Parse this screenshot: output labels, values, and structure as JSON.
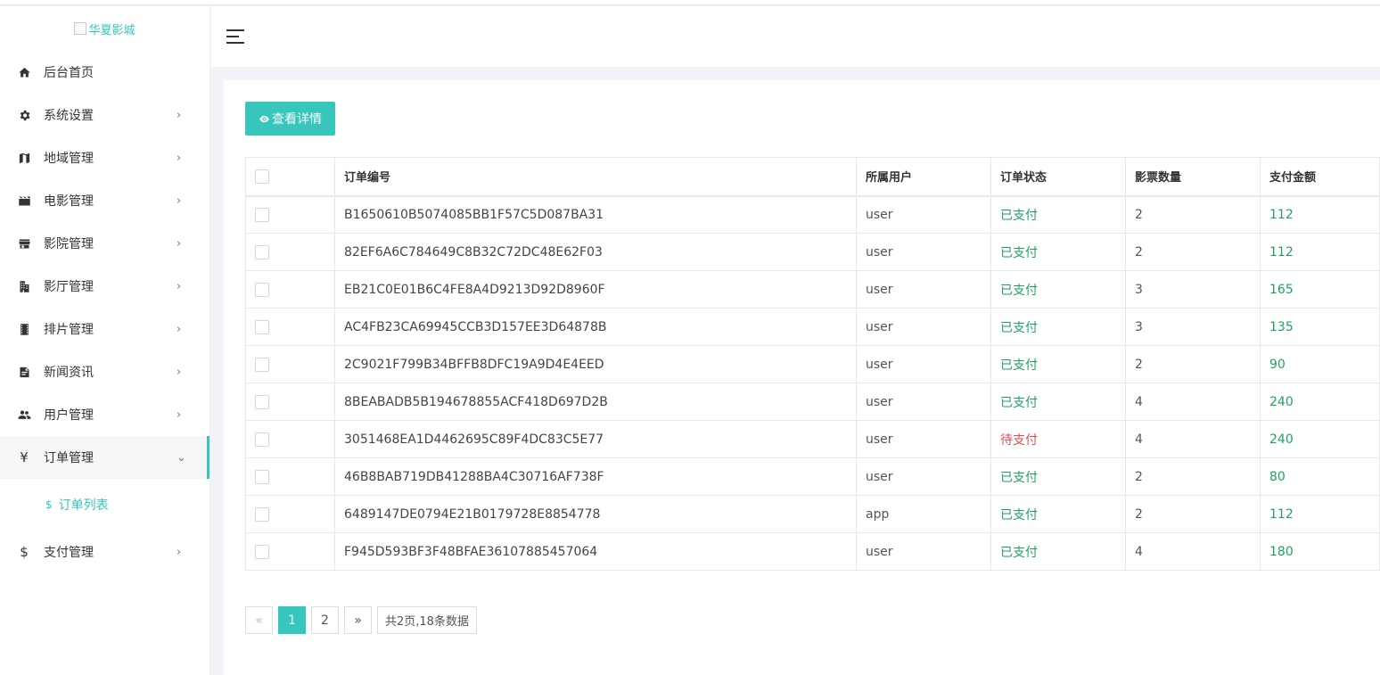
{
  "logo": {
    "alt_text": "华夏影城"
  },
  "sidebar": {
    "items": [
      {
        "label": "后台首页",
        "icon": "home-icon",
        "arrow": ""
      },
      {
        "label": "系统设置",
        "icon": "gear-icon",
        "arrow": "›"
      },
      {
        "label": "地域管理",
        "icon": "map-icon",
        "arrow": "›"
      },
      {
        "label": "电影管理",
        "icon": "film-icon",
        "arrow": "›"
      },
      {
        "label": "影院管理",
        "icon": "store-icon",
        "arrow": "›"
      },
      {
        "label": "影厅管理",
        "icon": "building-icon",
        "arrow": "›"
      },
      {
        "label": "排片管理",
        "icon": "filmstrip-icon",
        "arrow": "›"
      },
      {
        "label": "新闻资讯",
        "icon": "document-icon",
        "arrow": "›"
      },
      {
        "label": "用户管理",
        "icon": "users-icon",
        "arrow": "›"
      },
      {
        "label": "订单管理",
        "icon": "yen-icon",
        "arrow": "⌄"
      },
      {
        "label": "支付管理",
        "icon": "dollar-icon",
        "arrow": "›"
      }
    ],
    "sub_item": {
      "label": "订单列表",
      "icon_glyph": "$"
    },
    "yen_glyph": "¥",
    "dollar_glyph": "$"
  },
  "toolbar": {
    "detail_label": "查看详情"
  },
  "table": {
    "headers": [
      "订单编号",
      "所属用户",
      "订单状态",
      "影票数量",
      "支付金额"
    ],
    "rows": [
      {
        "order_no": "B1650610B5074085BB1F57C5D087BA31",
        "user": "user",
        "status": "已支付",
        "qty": "2",
        "amount": "112"
      },
      {
        "order_no": "82EF6A6C784649C8B32C72DC48E62F03",
        "user": "user",
        "status": "已支付",
        "qty": "2",
        "amount": "112"
      },
      {
        "order_no": "EB21C0E01B6C4FE8A4D9213D92D8960F",
        "user": "user",
        "status": "已支付",
        "qty": "3",
        "amount": "165"
      },
      {
        "order_no": "AC4FB23CA69945CCB3D157EE3D64878B",
        "user": "user",
        "status": "已支付",
        "qty": "3",
        "amount": "135"
      },
      {
        "order_no": "2C9021F799B34BFFB8DFC19A9D4E4EED",
        "user": "user",
        "status": "已支付",
        "qty": "2",
        "amount": "90"
      },
      {
        "order_no": "8BEABADB5B194678855ACF418D697D2B",
        "user": "user",
        "status": "已支付",
        "qty": "4",
        "amount": "240"
      },
      {
        "order_no": "3051468EA1D4462695C89F4DC83C5E77",
        "user": "user",
        "status": "待支付",
        "qty": "4",
        "amount": "240"
      },
      {
        "order_no": "46B8BAB719DB41288BA4C30716AF738F",
        "user": "user",
        "status": "已支付",
        "qty": "2",
        "amount": "80"
      },
      {
        "order_no": "6489147DE0794E21B0179728E8854778",
        "user": "app",
        "status": "已支付",
        "qty": "2",
        "amount": "112"
      },
      {
        "order_no": "F945D593BF3F48BFAE36107885457064",
        "user": "user",
        "status": "已支付",
        "qty": "4",
        "amount": "180"
      }
    ]
  },
  "pagination": {
    "prev": "«",
    "pages": [
      "1",
      "2"
    ],
    "current": "1",
    "next": "»",
    "info": "共2页,18条数据"
  },
  "colors": {
    "accent": "#36c6bb",
    "paid": "#1fa35c",
    "unpaid": "#e05050"
  }
}
